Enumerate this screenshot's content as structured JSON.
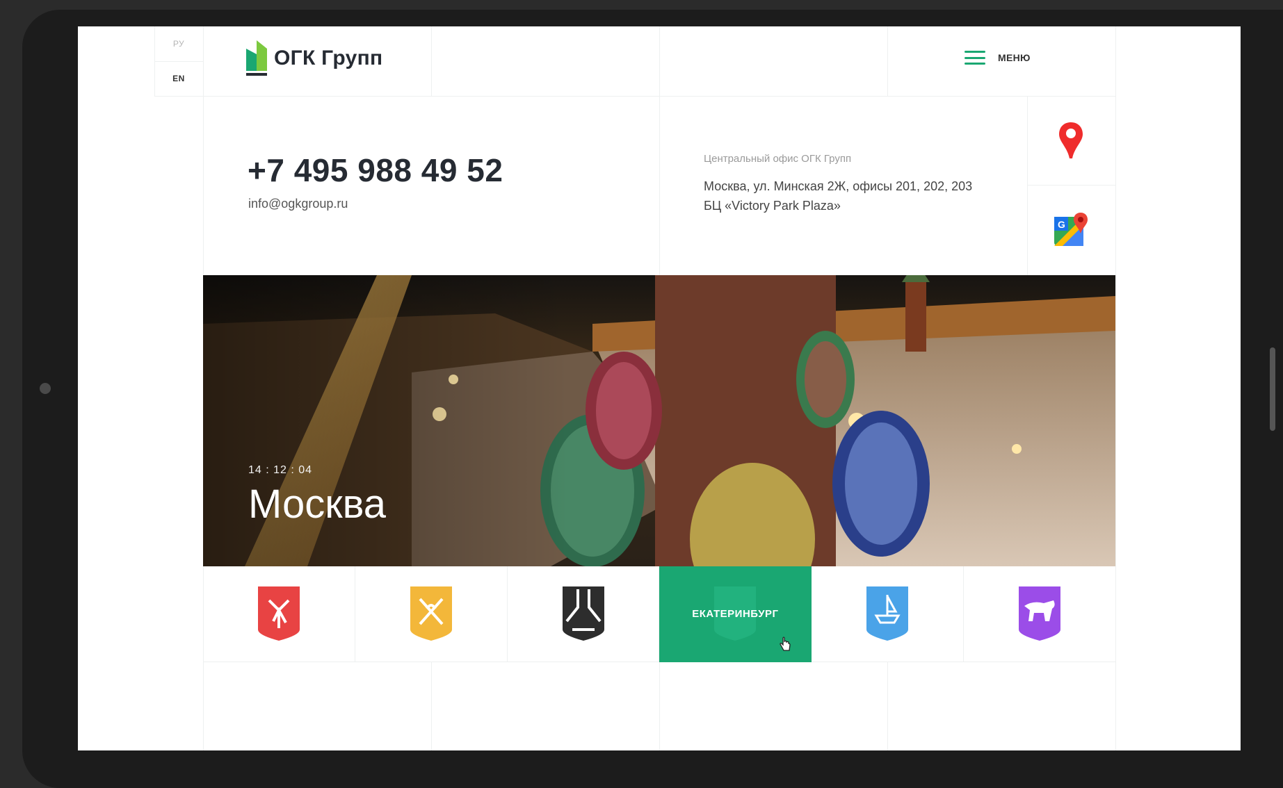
{
  "lang": {
    "ru": "РУ",
    "en": "EN"
  },
  "brand": {
    "name": "ОГК Групп"
  },
  "menu": {
    "label": "МЕНЮ"
  },
  "contact": {
    "phone": "+7 495 988 49 52",
    "email": "info@ogkgroup.ru",
    "office_label": "Центральный офис ОГК Групп",
    "address_line1": "Москва, ул. Минская 2Ж, офисы 201, 202, 203",
    "address_line2": "БЦ «Victory Park Plaza»"
  },
  "hero": {
    "time": "14 : 12 : 04",
    "city": "Москва"
  },
  "cities": [
    {
      "icon": "red-crest-icon",
      "color": "#e84343"
    },
    {
      "icon": "yellow-crest-icon",
      "color": "#f3b73a"
    },
    {
      "icon": "black-crest-icon",
      "color": "#2d2d2d"
    },
    {
      "icon": "green-crest-icon",
      "label": "ЕКАТЕРИНБУРГ",
      "color": "#1aa772",
      "active": true
    },
    {
      "icon": "blue-crest-icon",
      "color": "#4aa3e8"
    },
    {
      "icon": "purple-crest-icon",
      "color": "#9b4de8"
    }
  ],
  "colors": {
    "accent": "#1aa772",
    "text": "#262b33"
  }
}
